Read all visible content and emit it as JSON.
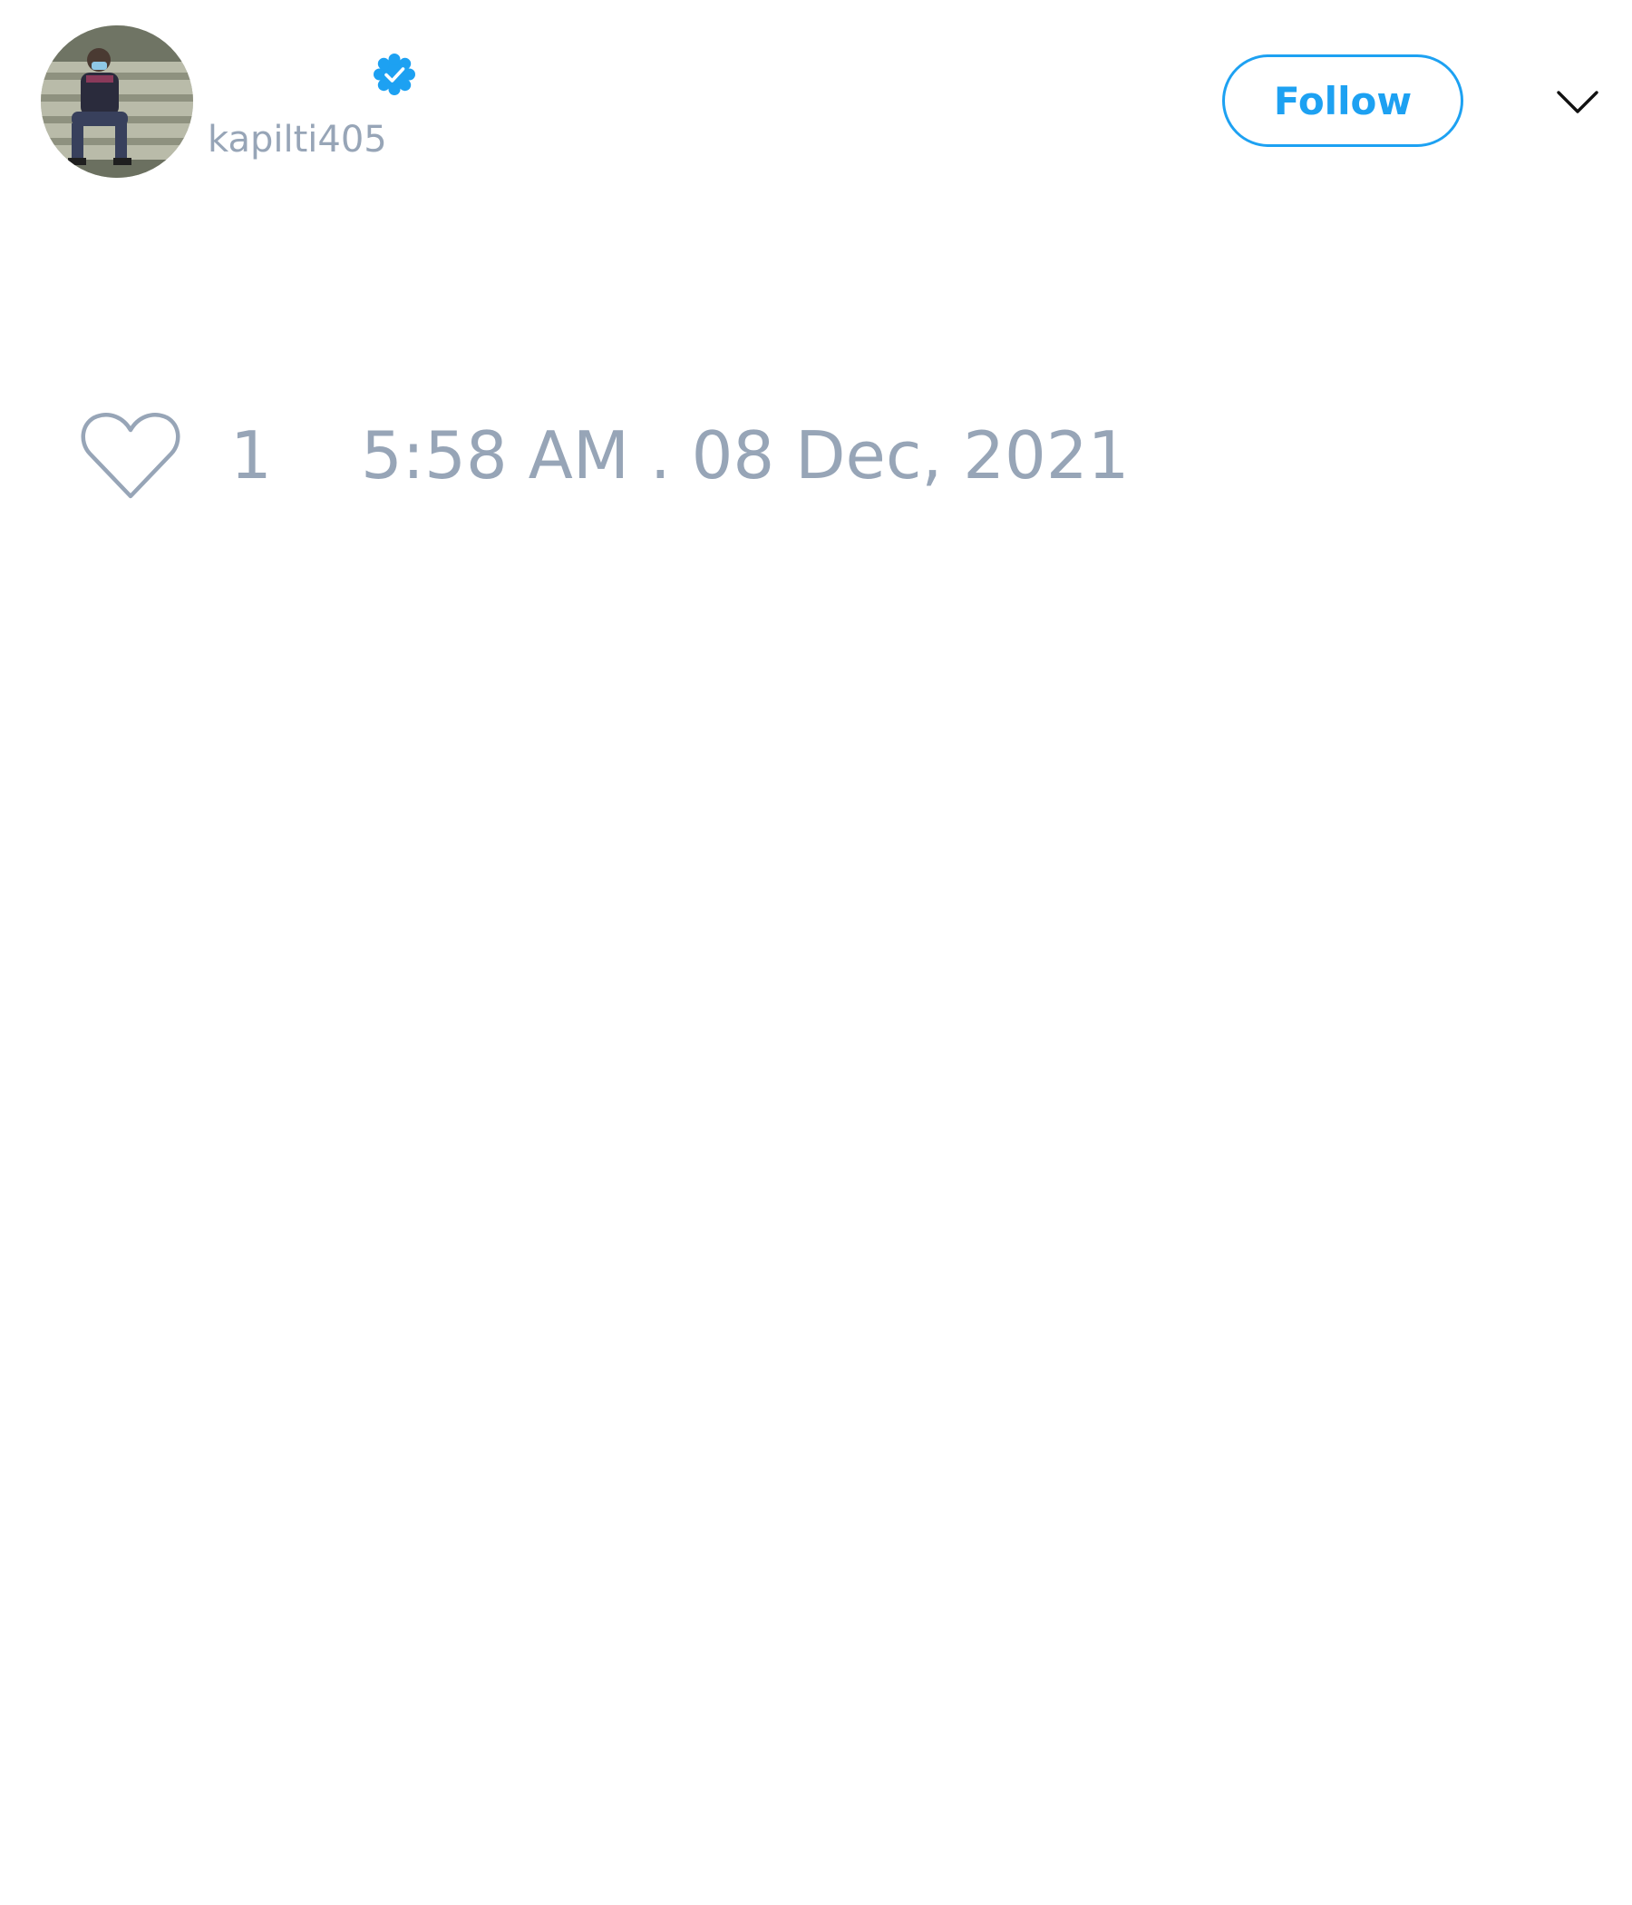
{
  "author": {
    "display_name": "",
    "handle": "kapilti405",
    "verified": true,
    "avatar_icon": "user-photo"
  },
  "header": {
    "follow_label": "Follow",
    "menu_icon": "chevron-down-icon"
  },
  "stats": {
    "like_icon": "heart-icon",
    "like_count": "1",
    "timestamp": "5:58 AM . 08 Dec, 2021"
  },
  "colors": {
    "accent": "#1da1f2",
    "muted_text": "#97a5b7",
    "background": "#ffffff"
  }
}
